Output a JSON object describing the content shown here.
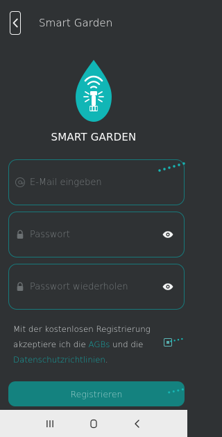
{
  "header": {
    "title": "Smart Garden"
  },
  "brand": {
    "title": "SMART GARDEN"
  },
  "form": {
    "email": {
      "placeholder": "E-Mail eingeben",
      "value": ""
    },
    "password": {
      "placeholder": "Passwort",
      "value": ""
    },
    "password_repeat": {
      "placeholder": "Passwort wiederholen",
      "value": ""
    }
  },
  "consent": {
    "text_before": "Mit der kostenlosen Registrierung akzeptiere ich die ",
    "agb_link": "AGBs",
    "text_middle": " und die ",
    "privacy_link": "Datenschutzrichtlinien",
    "text_after": "."
  },
  "actions": {
    "register_label": "Registrieren"
  },
  "icons": {
    "back": "chevron-left-icon",
    "logo": "water-drop-sprinkler-icon",
    "email": "at-sign-icon",
    "password": "lock-icon",
    "visibility": "eye-icon",
    "recent_apps": "recent-apps-icon",
    "home": "home-icon",
    "nav_back": "back-icon"
  },
  "colors": {
    "background": "#2f3234",
    "accent": "#14827f",
    "accent_light": "#16a6a5",
    "field_border": "#18797b",
    "text": "#ffffff",
    "nav_background": "#ececec"
  }
}
